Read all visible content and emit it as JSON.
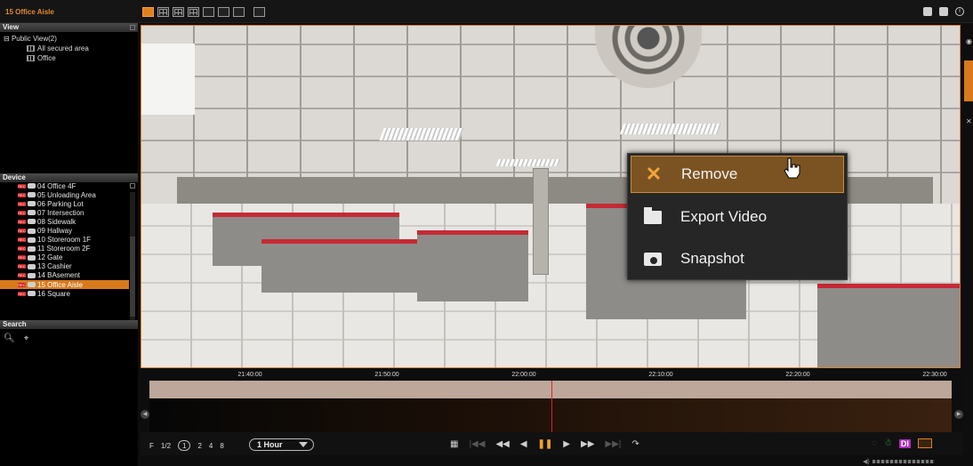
{
  "window": {
    "title": "15 Office Aisle"
  },
  "view_panel": {
    "header": "View",
    "root": "Public View(2)",
    "items": [
      "All secured area",
      "Office"
    ]
  },
  "device_panel": {
    "header": "Device",
    "rec_badge": "REC",
    "devices": [
      "04 Office 4F",
      "05 Unloading Area",
      "06 Parking Lot",
      "07 Intersection",
      "08 Sidewalk",
      "09 Hallway",
      "10 Storeroom 1F",
      "11 Storeroom 2F",
      "12 Gate",
      "13 Cashier",
      "14 BAsement",
      "15 Office Aisle",
      "16 Square"
    ],
    "selected_index": 11
  },
  "search_panel": {
    "header": "Search"
  },
  "context_menu": {
    "items": [
      {
        "label": "Remove",
        "icon": "x-icon",
        "highlighted": true
      },
      {
        "label": "Export Video",
        "icon": "folder-icon",
        "highlighted": false
      },
      {
        "label": "Snapshot",
        "icon": "camera-icon",
        "highlighted": false
      }
    ]
  },
  "timeline": {
    "ticks": [
      "21:40:00",
      "21:50:00",
      "22:00:00",
      "22:10:00",
      "22:20:00",
      "22:30:00"
    ]
  },
  "playback": {
    "frame_label": "F",
    "speed_label": "1/2",
    "speeds": [
      "1",
      "2",
      "4",
      "8"
    ],
    "selected_speed": "1",
    "range": "1 Hour",
    "di_label": "DI"
  },
  "colors": {
    "accent": "#d87a1c",
    "rec": "#d21f1f",
    "timeline_marker": "#e02020",
    "di": "#b02cc0"
  }
}
